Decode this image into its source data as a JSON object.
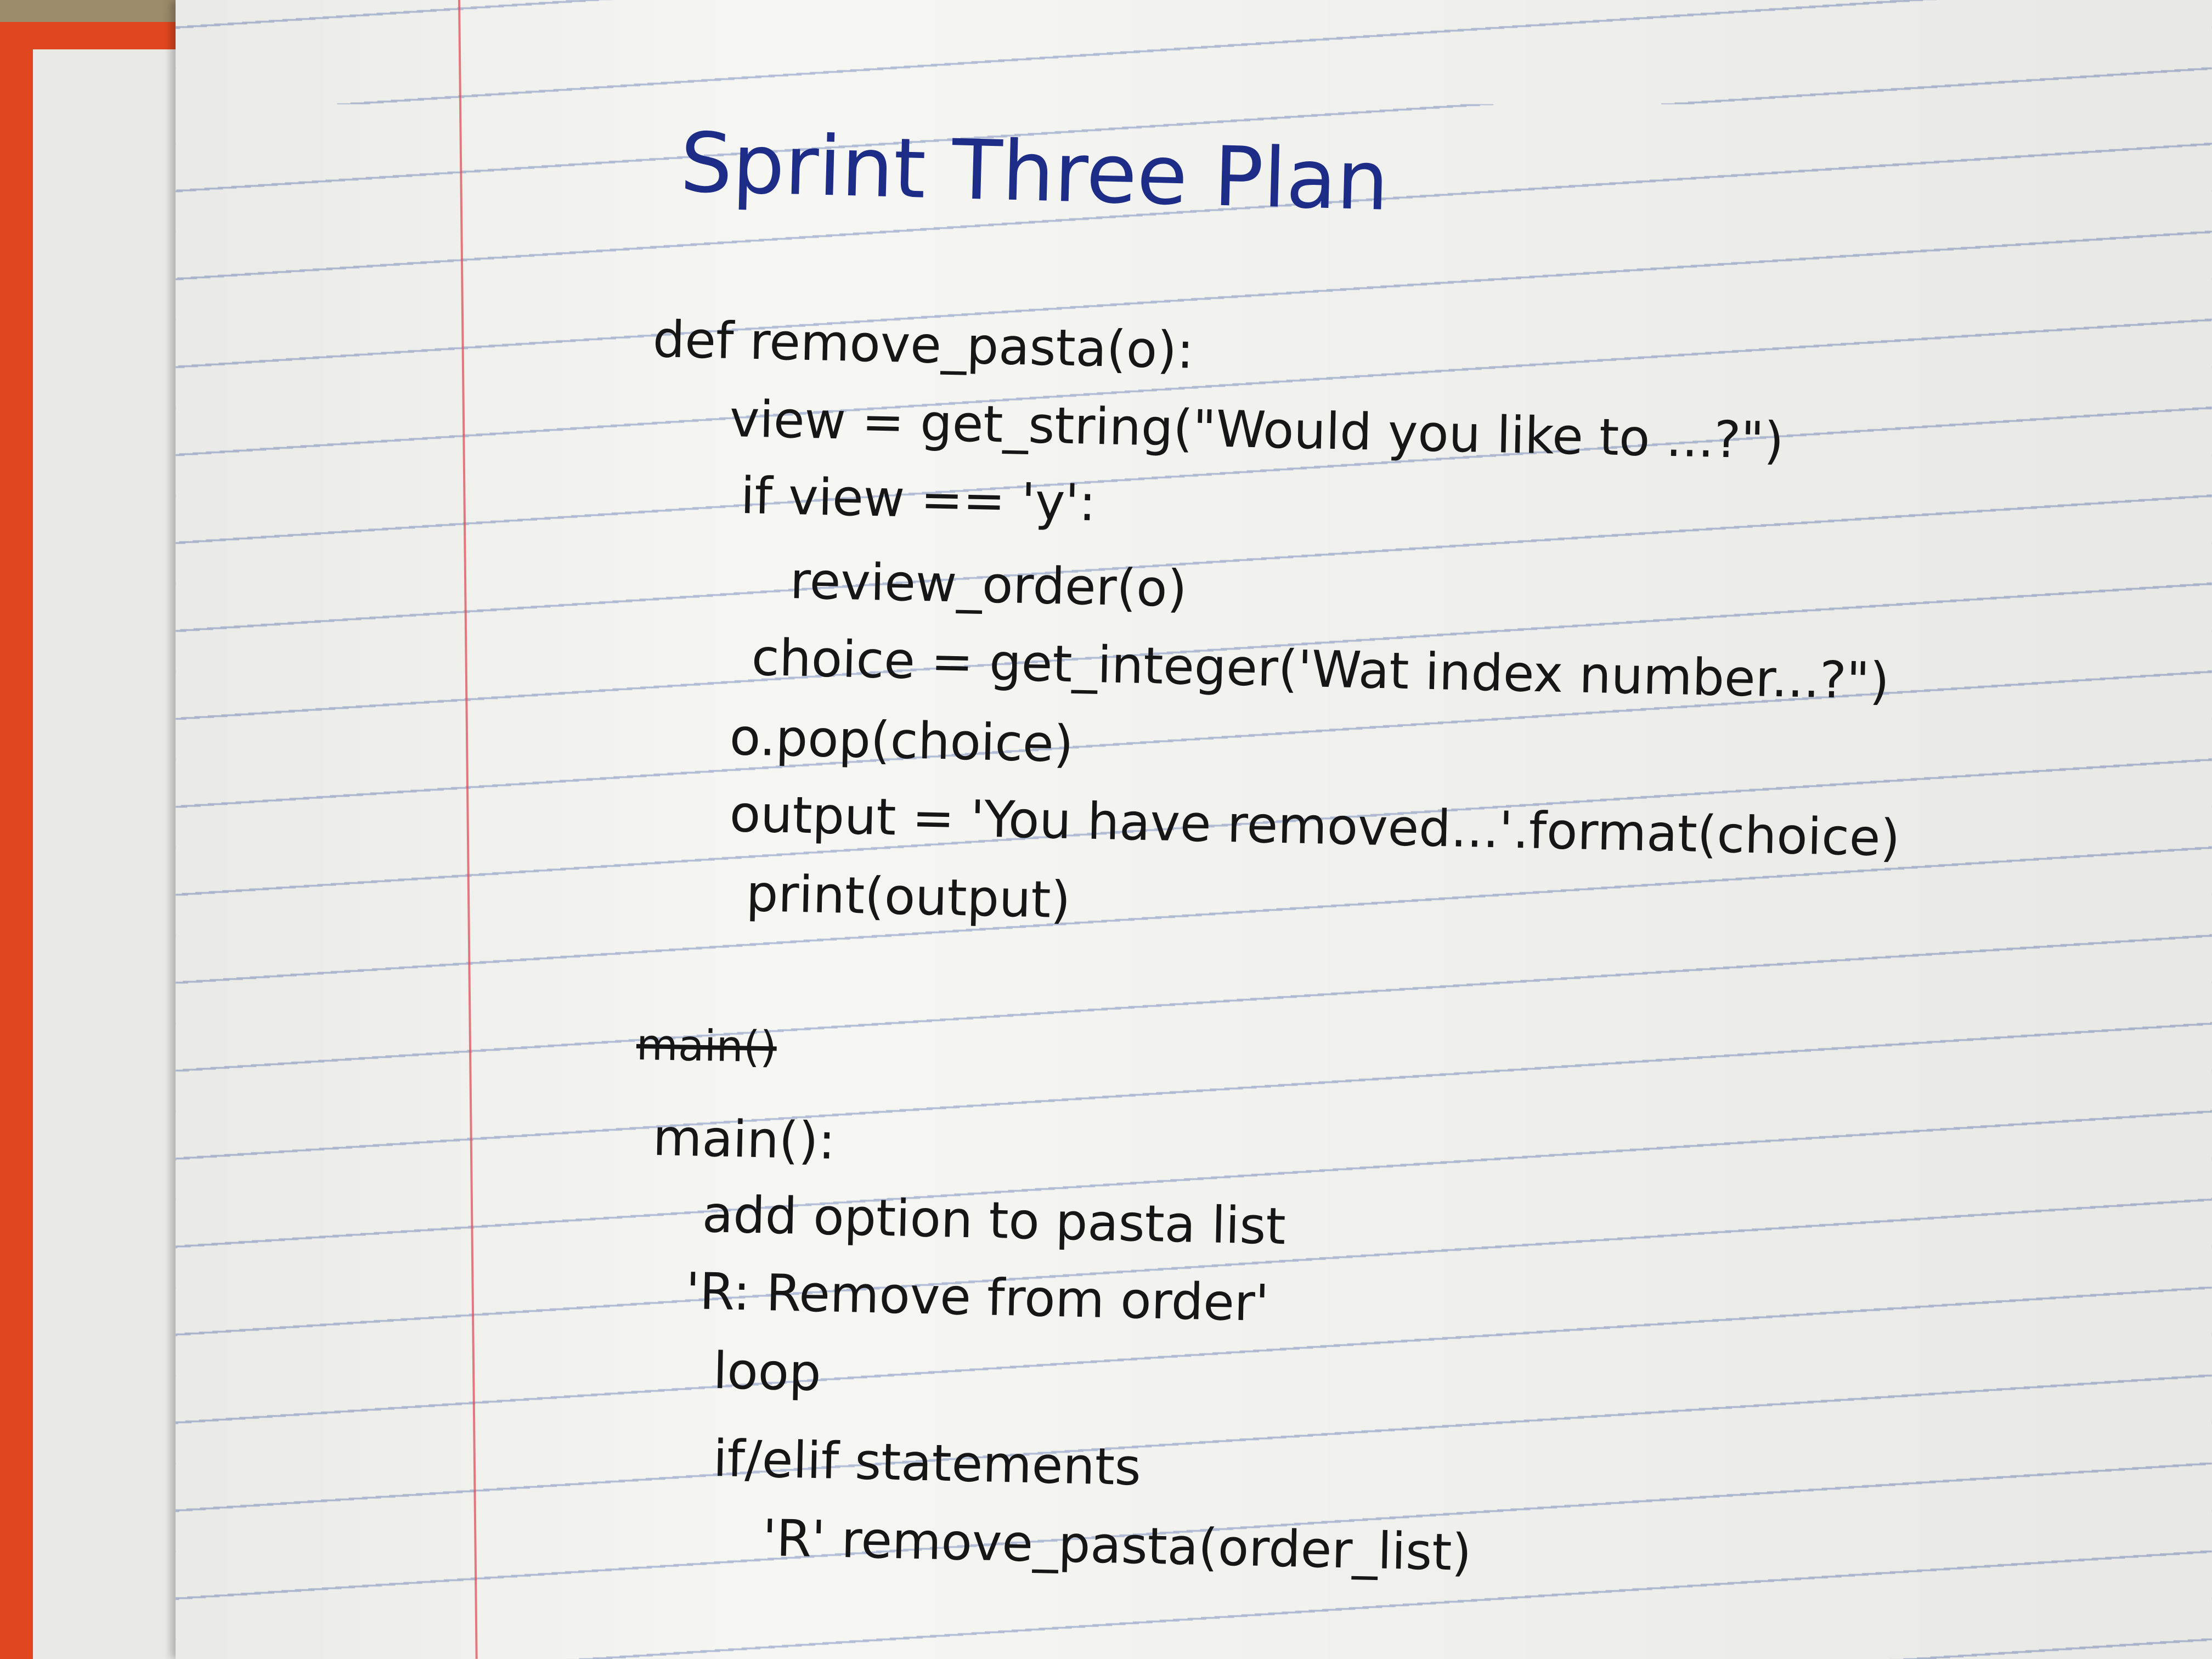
{
  "notebook": {
    "title": "Sprint Three Plan",
    "lines": [
      "def remove_pasta(o):",
      "view = get_string(\"Would you like to ...?\")",
      "if view == 'y':",
      "review_order(o)",
      "choice = get_integer('Wat index number...?\")",
      "o.pop(choice)",
      "output = 'You have removed...'.format(choice)",
      "print(output)"
    ],
    "struck_text": "main()",
    "main_lines": [
      "main():",
      "add option to pasta list",
      "'R: Remove from order'",
      "loop",
      "if/elif statements",
      "'R' remove_pasta(order_list)"
    ]
  },
  "colors": {
    "title_ink": "#1d2c86",
    "body_ink": "#161616",
    "rule_lines": "#788cbe",
    "margin_line": "#dc505a",
    "cover": "#e0471f"
  }
}
